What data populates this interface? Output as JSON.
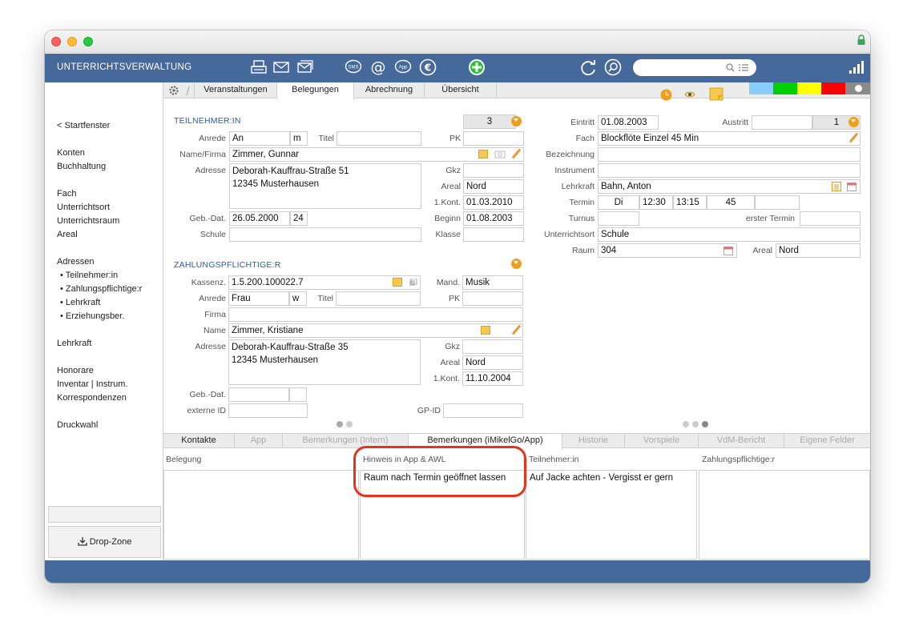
{
  "app": {
    "title": "UNTERRICHTSVERWALTUNG"
  },
  "sidebar": {
    "back": "< Startfenster",
    "items": [
      "Konten",
      "Buchhaltung",
      "Fach",
      "Unterrichtsort",
      "Unterrichtsraum",
      "Areal",
      "Adressen",
      "• Teilnehmer:in",
      "• Zahlungspflichtige:r",
      "• Lehrkraft",
      "• Erziehungsber.",
      "Lehrkraft",
      "Honorare",
      "Inventar | Instrum.",
      "Korrespondenzen",
      "Druckwahl"
    ],
    "dropzone": "Drop-Zone"
  },
  "tabs": [
    "Veranstaltungen",
    "Belegungen",
    "Abrechnung",
    "Übersicht"
  ],
  "colors": {
    "appbar": "#46699c",
    "swatches": [
      "#87cefa",
      "#00d000",
      "#ffff00",
      "#ff0000"
    ]
  },
  "teilnehmer": {
    "section": "TEILNEHMER:IN",
    "count": "3",
    "anrede_label": "Anrede",
    "anrede": "An",
    "gender": "m",
    "titel_label": "Titel",
    "pk_label": "PK",
    "name_label": "Name/Firma",
    "name": "Zimmer, Gunnar",
    "adresse_label": "Adresse",
    "street": "Deborah-Kauffrau-Straße 51",
    "city": "12345 Musterhausen",
    "gkz_label": "Gkz",
    "areal_label": "Areal",
    "areal": "Nord",
    "kont_label": "1.Kont.",
    "kont": "01.03.2010",
    "geb_label": "Geb.-Dat.",
    "geb": "26.05.2000",
    "age": "24",
    "beginn_label": "Beginn",
    "beginn": "01.08.2003",
    "schule_label": "Schule",
    "klasse_label": "Klasse"
  },
  "zahlung": {
    "section": "ZAHLUNGSPFLICHTIGE:R",
    "kassenz_label": "Kassenz.",
    "kassenz": "1.5.200.100022.7",
    "mand_label": "Mand.",
    "mand": "Musik",
    "anrede_label": "Anrede",
    "anrede": "Frau",
    "gender": "w",
    "titel_label": "Titel",
    "pk_label": "PK",
    "firma_label": "Firma",
    "name_label": "Name",
    "name": "Zimmer, Kristiane",
    "adresse_label": "Adresse",
    "street": "Deborah-Kauffrau-Straße 35",
    "city": "12345 Musterhausen",
    "gkz_label": "Gkz",
    "areal_label": "Areal",
    "areal": "Nord",
    "kont_label": "1.Kont.",
    "kont": "11.10.2004",
    "geb_label": "Geb.-Dat.",
    "extid_label": "externe ID",
    "gpid_label": "GP-ID"
  },
  "belegung": {
    "eintritt_label": "Eintritt",
    "eintritt": "01.08.2003",
    "austritt_label": "Austritt",
    "austritt_count": "1",
    "fach_label": "Fach",
    "fach": "Blockflöte Einzel 45 Min",
    "bez_label": "Bezeichnung",
    "instr_label": "Instrument",
    "lehrkraft_label": "Lehrkraft",
    "lehrkraft": "Bahn, Anton",
    "termin_label": "Termin",
    "day": "Di",
    "start": "12:30",
    "end": "13:15",
    "duration": "45",
    "turnus_label": "Turnus",
    "erster_label": "erster Termin",
    "ort_label": "Unterrichtsort",
    "ort": "Schule",
    "raum_label": "Raum",
    "raum": "304",
    "areal_label": "Areal",
    "areal": "Nord"
  },
  "bottom_tabs": [
    "Kontakte",
    "App",
    "Bemerkungen (Intern)",
    "Bemerkungen (iMikelGo/App)",
    "Historie",
    "Vorspiele",
    "VdM-Bericht",
    "Eigene Felder"
  ],
  "notes": {
    "col1": "Belegung",
    "col2": "Hinweis in App & AWL",
    "col3": "Teilnehmer:in",
    "col4": "Zahlungspflichtige:r",
    "app_note": "Raum nach Termin geöffnet lassen",
    "tn_note": "Auf Jacke achten - Vergisst er gern"
  }
}
